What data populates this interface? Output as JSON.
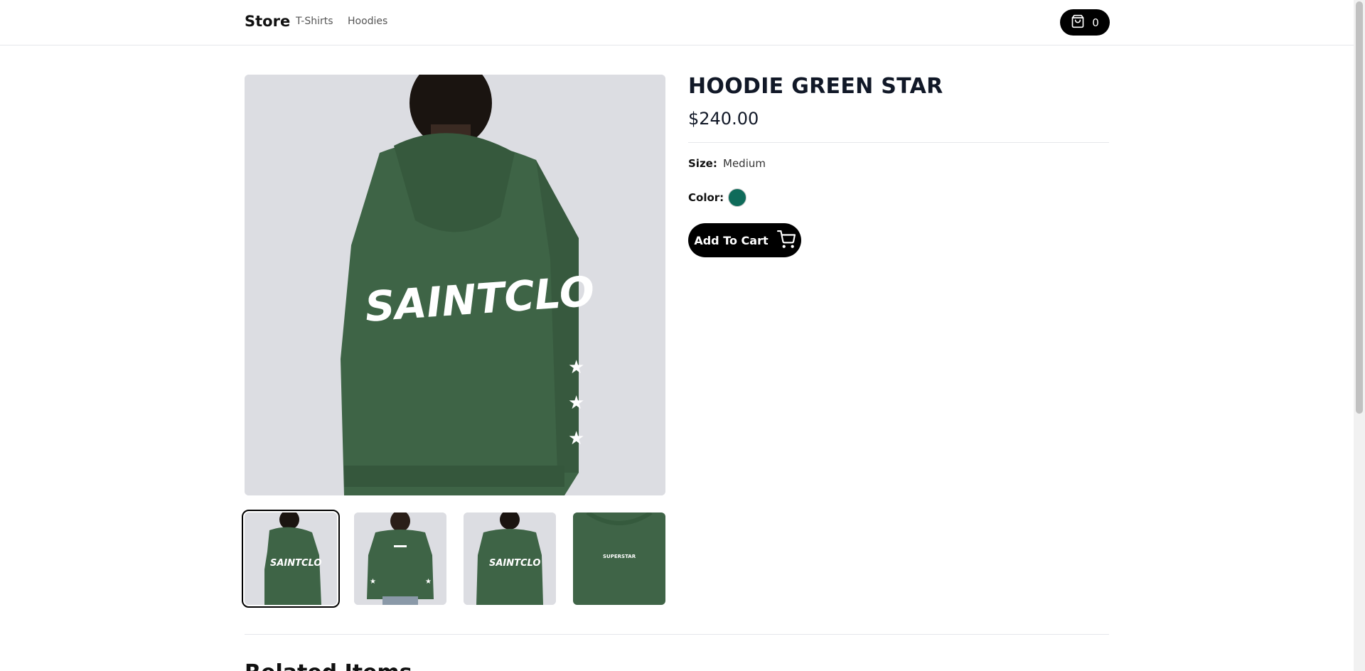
{
  "header": {
    "brand": "Store",
    "nav": [
      {
        "label": "T-Shirts"
      },
      {
        "label": "Hoodies"
      }
    ],
    "cart": {
      "icon": "shopping-bag-icon",
      "count": "0"
    }
  },
  "product": {
    "title": "HOODIE GREEN STAR",
    "price": "$240.00",
    "size_label": "Size:",
    "size_value": "Medium",
    "color_label": "Color:",
    "color_hex": "#0f6b5a",
    "add_to_cart_label": "Add To Cart",
    "add_to_cart_icon": "shopping-cart-icon",
    "main_image": {
      "alt": "SAINTCLO"
    },
    "thumbnails": [
      {
        "selected": true,
        "graphic": "SAINTCLO"
      },
      {
        "selected": false,
        "graphic": ""
      },
      {
        "selected": false,
        "graphic": "SAINTCLO"
      },
      {
        "selected": false,
        "graphic": "SUPERSTAR"
      }
    ]
  },
  "related": {
    "heading": "Related Items"
  },
  "colors": {
    "hoodie_green": "#3e6446",
    "background_gray": "#dcdde2",
    "accent_black": "#000000"
  }
}
